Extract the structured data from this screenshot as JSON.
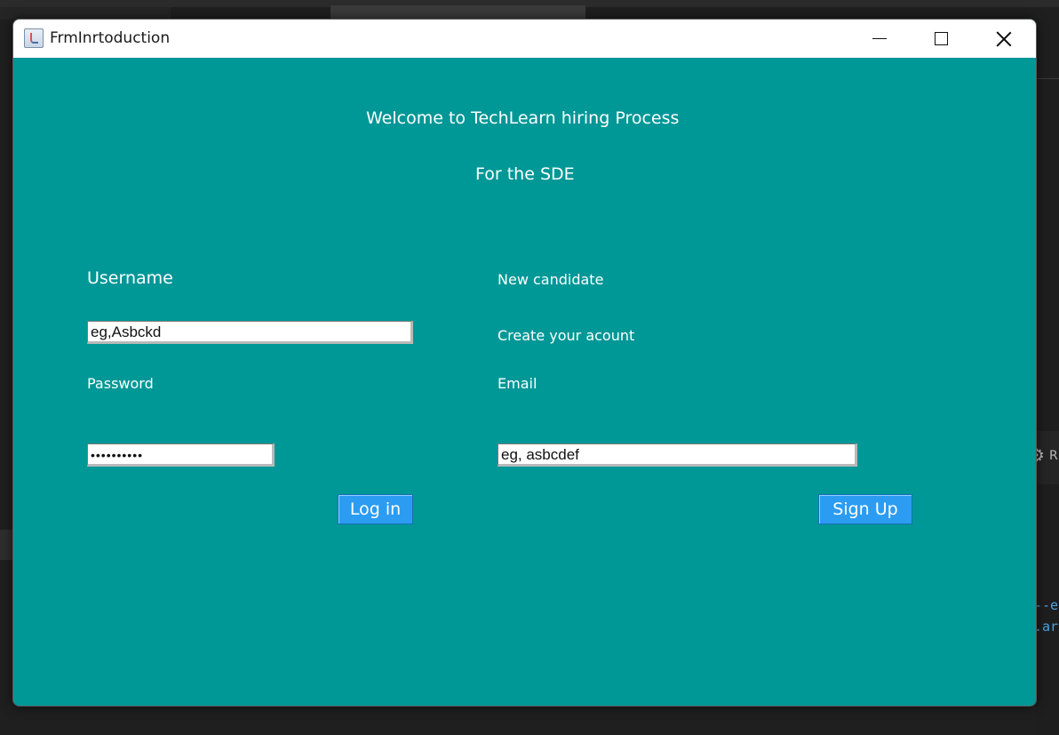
{
  "window": {
    "title": "FrmInrtoduction"
  },
  "header": {
    "welcome": "Welcome to TechLearn hiring Process",
    "subtitle": "For the SDE"
  },
  "login": {
    "username_label": "Username",
    "username_value": "eg,Asbckd",
    "password_label": "Password",
    "password_value": "••••••••••",
    "login_button": "Log in"
  },
  "signup": {
    "new_candidate_label": "New candidate",
    "create_account_label": "Create your acount",
    "email_label": "Email",
    "email_value": "eg, asbcdef",
    "signup_button": "Sign Up"
  },
  "background": {
    "code_line_1": "--e",
    "code_line_2": ".ar",
    "side_letter": "R"
  },
  "colors": {
    "window_bg": "#009797",
    "button_bg": "#2b9cf2",
    "label_text": "#ffffff"
  }
}
